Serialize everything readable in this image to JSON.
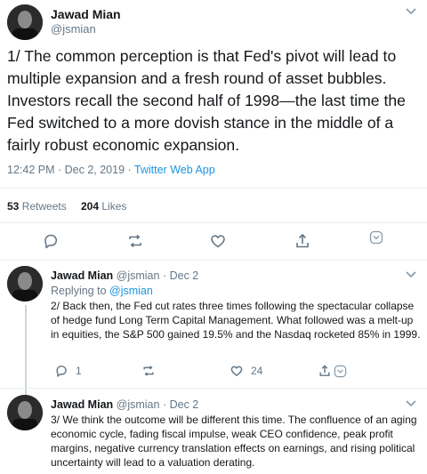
{
  "main_tweet": {
    "author_name": "Jawad Mian",
    "author_handle": "@jsmian",
    "text": "1/ The common perception is that Fed's pivot will lead to multiple expansion and a fresh round of asset bubbles. Investors recall the second half of 1998—the last time the Fed switched to a more dovish stance in the middle of a fairly robust economic expansion.",
    "time": "12:42 PM · Dec 2, 2019 · ",
    "source": "Twitter Web App",
    "retweets_count": "53",
    "retweets_label": "Retweets",
    "likes_count": "204",
    "likes_label": "Likes"
  },
  "replies": [
    {
      "author_name": "Jawad Mian",
      "author_handle": "@jsmian",
      "date": "· Dec 2",
      "replying_prefix": "Replying to ",
      "replying_handle": "@jsmian",
      "text": "2/ Back then, the Fed cut rates three times following the spectacular collapse of hedge fund Long Term Capital Management. What followed was a melt-up in equities, the S&P 500 gained 19.5% and the Nasdaq rocketed 85% in 1999.",
      "reply_count": "1",
      "like_count": "24"
    },
    {
      "author_name": "Jawad Mian",
      "author_handle": "@jsmian",
      "date": "· Dec 2",
      "text": "3/ We think the outcome will be different this time. The confluence of an aging economic cycle, fading fiscal impulse, weak CEO confidence, peak profit margins, negative currency translation effects on earnings, and rising political uncertainty will lead to a valuation derating."
    }
  ]
}
